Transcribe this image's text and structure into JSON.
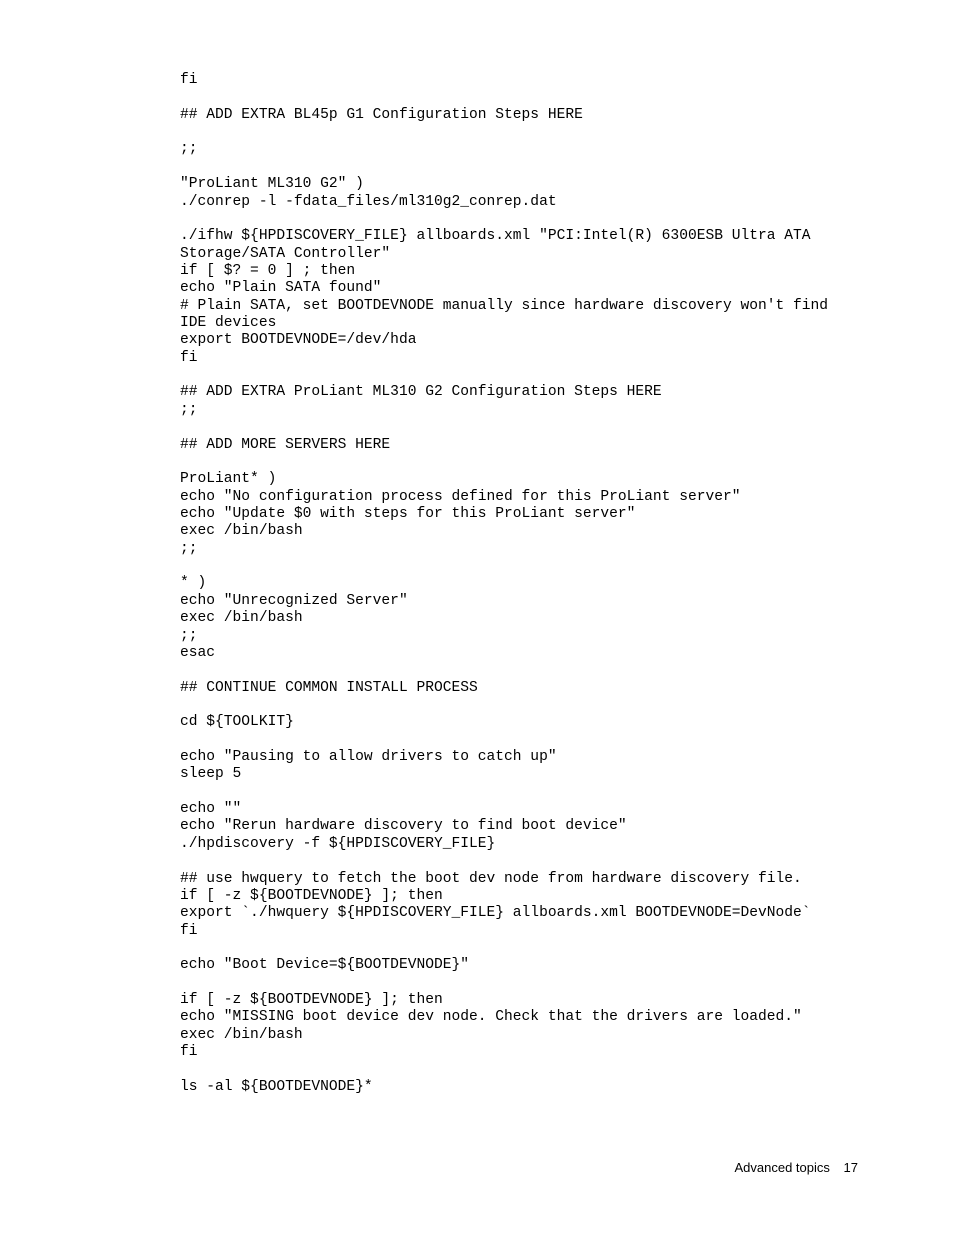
{
  "code_lines": [
    "fi",
    "",
    "## ADD EXTRA BL45p G1 Configuration Steps HERE",
    "",
    ";;",
    "",
    "\"ProLiant ML310 G2\" )",
    "./conrep -l -fdata_files/ml310g2_conrep.dat",
    "",
    "./ifhw ${HPDISCOVERY_FILE} allboards.xml \"PCI:Intel(R) 6300ESB Ultra ATA Storage/SATA Controller\"",
    "if [ $? = 0 ] ; then",
    "echo \"Plain SATA found\"",
    "# Plain SATA, set BOOTDEVNODE manually since hardware discovery won't find IDE devices",
    "export BOOTDEVNODE=/dev/hda",
    "fi",
    "",
    "## ADD EXTRA ProLiant ML310 G2 Configuration Steps HERE",
    ";;",
    "",
    "## ADD MORE SERVERS HERE",
    "",
    "ProLiant* )",
    "echo \"No configuration process defined for this ProLiant server\"",
    "echo \"Update $0 with steps for this ProLiant server\"",
    "exec /bin/bash",
    ";;",
    "",
    "* )",
    "echo \"Unrecognized Server\"",
    "exec /bin/bash",
    ";;",
    "esac",
    "",
    "## CONTINUE COMMON INSTALL PROCESS",
    "",
    "cd ${TOOLKIT}",
    "",
    "echo \"Pausing to allow drivers to catch up\"",
    "sleep 5",
    "",
    "echo \"\"",
    "echo \"Rerun hardware discovery to find boot device\"",
    "./hpdiscovery -f ${HPDISCOVERY_FILE}",
    "",
    "## use hwquery to fetch the boot dev node from hardware discovery file.",
    "if [ -z ${BOOTDEVNODE} ]; then",
    "export `./hwquery ${HPDISCOVERY_FILE} allboards.xml BOOTDEVNODE=DevNode`",
    "fi",
    "",
    "echo \"Boot Device=${BOOTDEVNODE}\"",
    "",
    "if [ -z ${BOOTDEVNODE} ]; then",
    "echo \"MISSING boot device dev node. Check that the drivers are loaded.\"",
    "exec /bin/bash",
    "fi",
    "",
    "ls -al ${BOOTDEVNODE}*"
  ],
  "footer": {
    "section": "Advanced topics",
    "page_number": "17"
  }
}
